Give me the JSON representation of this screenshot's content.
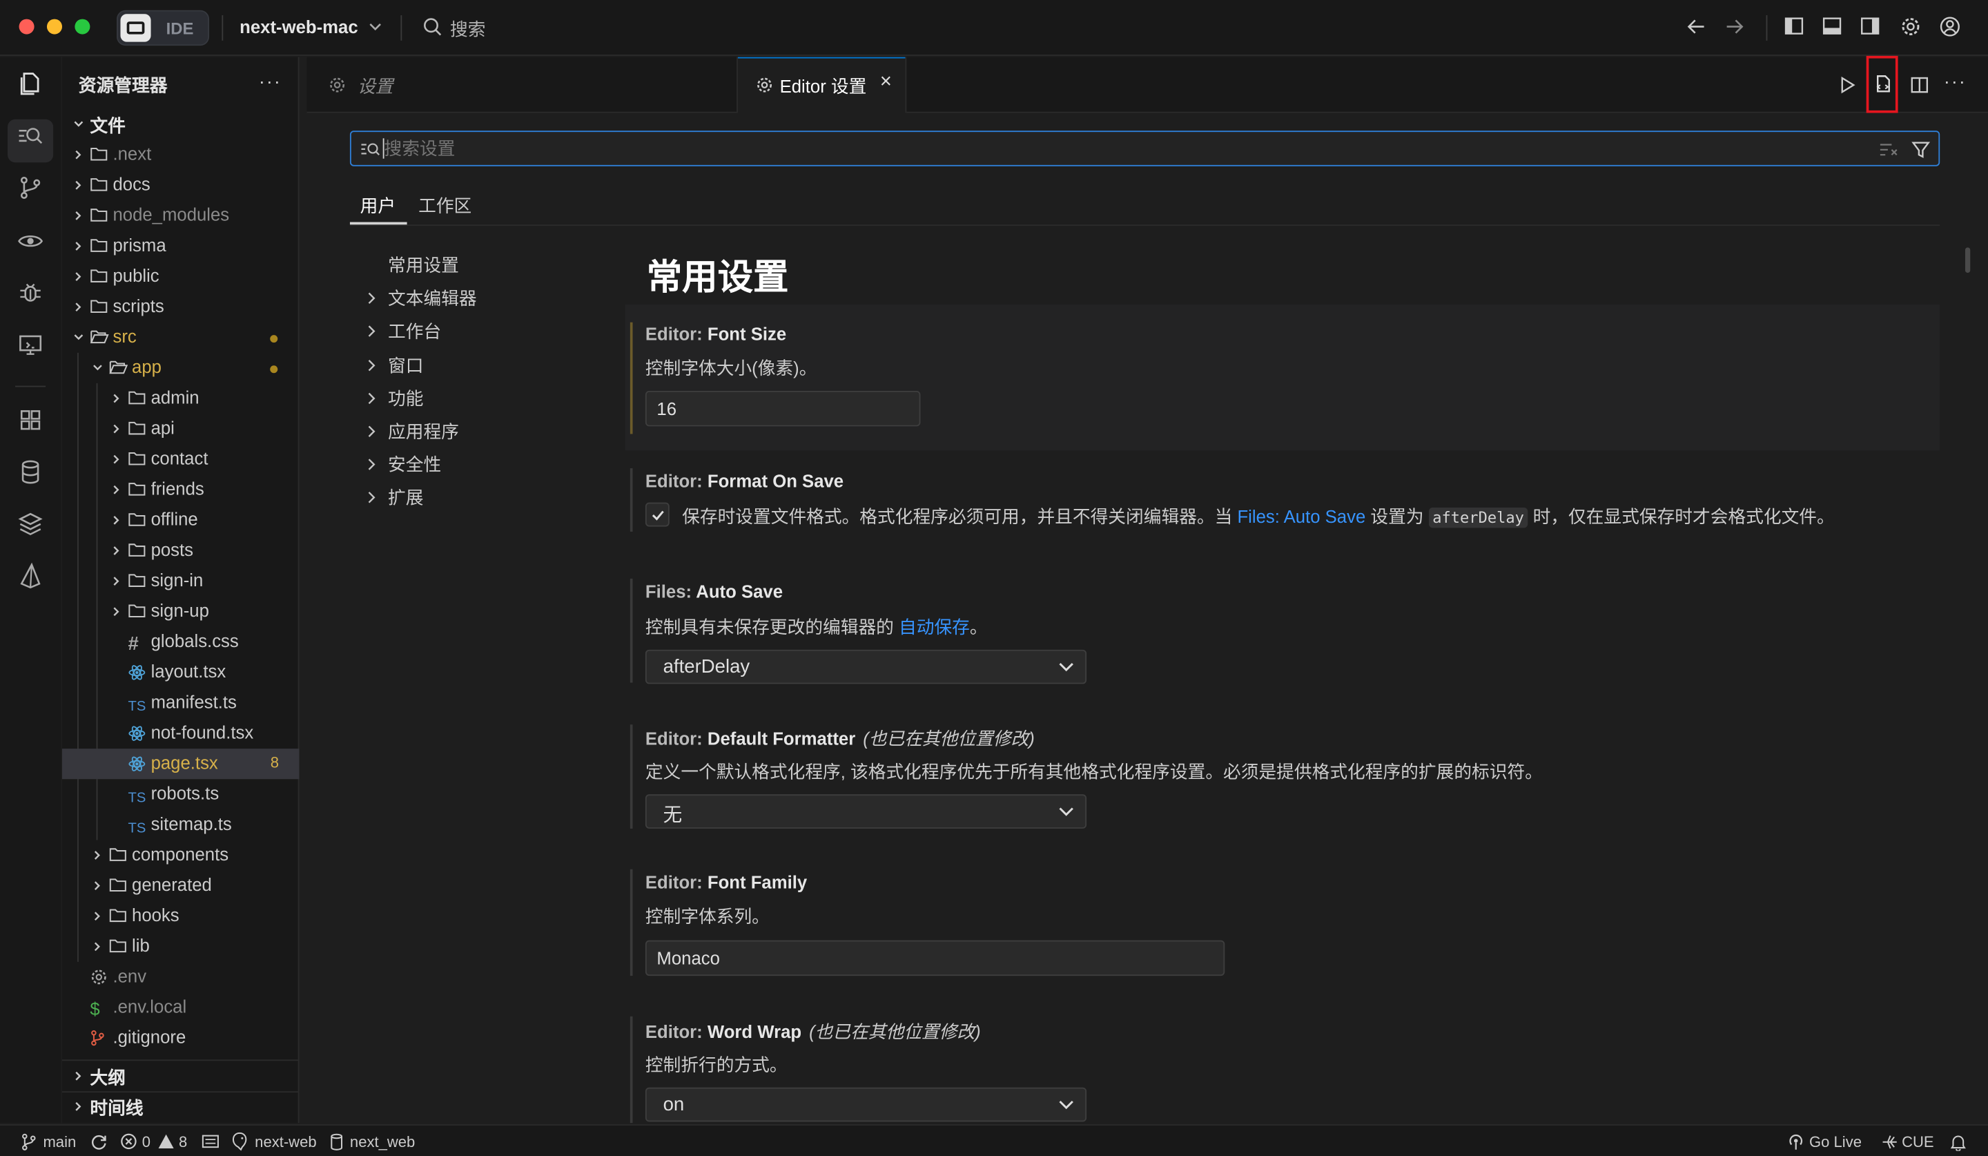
{
  "titlebar": {
    "badge": "IDE",
    "project": "next-web-mac",
    "search_label": "搜索"
  },
  "explorer": {
    "title": "资源管理器",
    "more": "···",
    "root_label": "文件",
    "tree": [
      {
        "label": ".next",
        "type": "folder",
        "depth": 0,
        "dim": true
      },
      {
        "label": "docs",
        "type": "folder",
        "depth": 0
      },
      {
        "label": "node_modules",
        "type": "folder",
        "depth": 0,
        "dim": true
      },
      {
        "label": "prisma",
        "type": "folder",
        "depth": 0
      },
      {
        "label": "public",
        "type": "folder",
        "depth": 0
      },
      {
        "label": "scripts",
        "type": "folder",
        "depth": 0
      },
      {
        "label": "src",
        "type": "folder-open",
        "depth": 0,
        "modified": true
      },
      {
        "label": "app",
        "type": "folder-open",
        "depth": 1,
        "modified": true
      },
      {
        "label": "admin",
        "type": "folder",
        "depth": 2
      },
      {
        "label": "api",
        "type": "folder",
        "depth": 2
      },
      {
        "label": "contact",
        "type": "folder",
        "depth": 2
      },
      {
        "label": "friends",
        "type": "folder",
        "depth": 2
      },
      {
        "label": "offline",
        "type": "folder",
        "depth": 2
      },
      {
        "label": "posts",
        "type": "folder",
        "depth": 2
      },
      {
        "label": "sign-in",
        "type": "folder",
        "depth": 2
      },
      {
        "label": "sign-up",
        "type": "folder",
        "depth": 2
      },
      {
        "label": "globals.css",
        "type": "css",
        "depth": 2
      },
      {
        "label": "layout.tsx",
        "type": "react",
        "depth": 2
      },
      {
        "label": "manifest.ts",
        "type": "ts",
        "depth": 2
      },
      {
        "label": "not-found.tsx",
        "type": "react",
        "depth": 2
      },
      {
        "label": "page.tsx",
        "type": "react",
        "depth": 2,
        "selected": true,
        "problems": "8"
      },
      {
        "label": "robots.ts",
        "type": "ts",
        "depth": 2
      },
      {
        "label": "sitemap.ts",
        "type": "ts",
        "depth": 2
      },
      {
        "label": "components",
        "type": "folder",
        "depth": 1
      },
      {
        "label": "generated",
        "type": "folder",
        "depth": 1
      },
      {
        "label": "hooks",
        "type": "folder",
        "depth": 1
      },
      {
        "label": "lib",
        "type": "folder",
        "depth": 1
      },
      {
        "label": ".env",
        "type": "gear",
        "depth": 0,
        "dim": true
      },
      {
        "label": ".env.local",
        "type": "dollar",
        "depth": 0,
        "dim": true
      },
      {
        "label": ".gitignore",
        "type": "git",
        "depth": 0
      }
    ],
    "outline_label": "大纲",
    "timeline_label": "时间线"
  },
  "editor": {
    "tab1_label": "设置",
    "tab2_label": "Editor 设置",
    "tab_close": "×"
  },
  "settings": {
    "search_placeholder": "搜索设置",
    "scope_user": "用户",
    "scope_workspace": "工作区",
    "toc": [
      "常用设置",
      "文本编辑器",
      "工作台",
      "窗口",
      "功能",
      "应用程序",
      "安全性",
      "扩展"
    ],
    "section_title": "常用设置",
    "font_size": {
      "category": "Editor: ",
      "name": "Font Size",
      "desc": "控制字体大小(像素)。",
      "value": "16"
    },
    "format_on_save": {
      "category": "Editor: ",
      "name": "Format On Save",
      "desc_a": "保存时设置文件格式。格式化程序必须可用，并且不得关闭编辑器。当 ",
      "link": "Files: Auto Save",
      "desc_b": " 设置为 ",
      "code": "afterDelay",
      "desc_c": " 时，仅在显式保存时才会格式化文件。",
      "checked": true
    },
    "auto_save": {
      "category": "Files: ",
      "name": "Auto Save",
      "desc_a": "控制具有未保存更改的编辑器的 ",
      "link": "自动保存",
      "desc_b": "。",
      "value": "afterDelay"
    },
    "default_formatter": {
      "category": "Editor: ",
      "name": "Default Formatter",
      "modified": "(也已在其他位置修改)",
      "desc": "定义一个默认格式化程序, 该格式化程序优先于所有其他格式化程序设置。必须是提供格式化程序的扩展的标识符。",
      "value": "无"
    },
    "font_family": {
      "category": "Editor: ",
      "name": "Font Family",
      "desc": "控制字体系列。",
      "value": "Monaco"
    },
    "word_wrap": {
      "category": "Editor: ",
      "name": "Word Wrap",
      "modified": "(也已在其他位置修改)",
      "desc": "控制折行的方式。",
      "value": "on"
    }
  },
  "statusbar": {
    "branch": "main",
    "errors": "0",
    "warnings": "8",
    "remote": "next-web",
    "db": "next_web",
    "golive": "Go Live",
    "cue": "CUE"
  },
  "colors": {
    "accent": "#0078d4",
    "link": "#3794ff",
    "highlight_box": "#e5161f"
  }
}
